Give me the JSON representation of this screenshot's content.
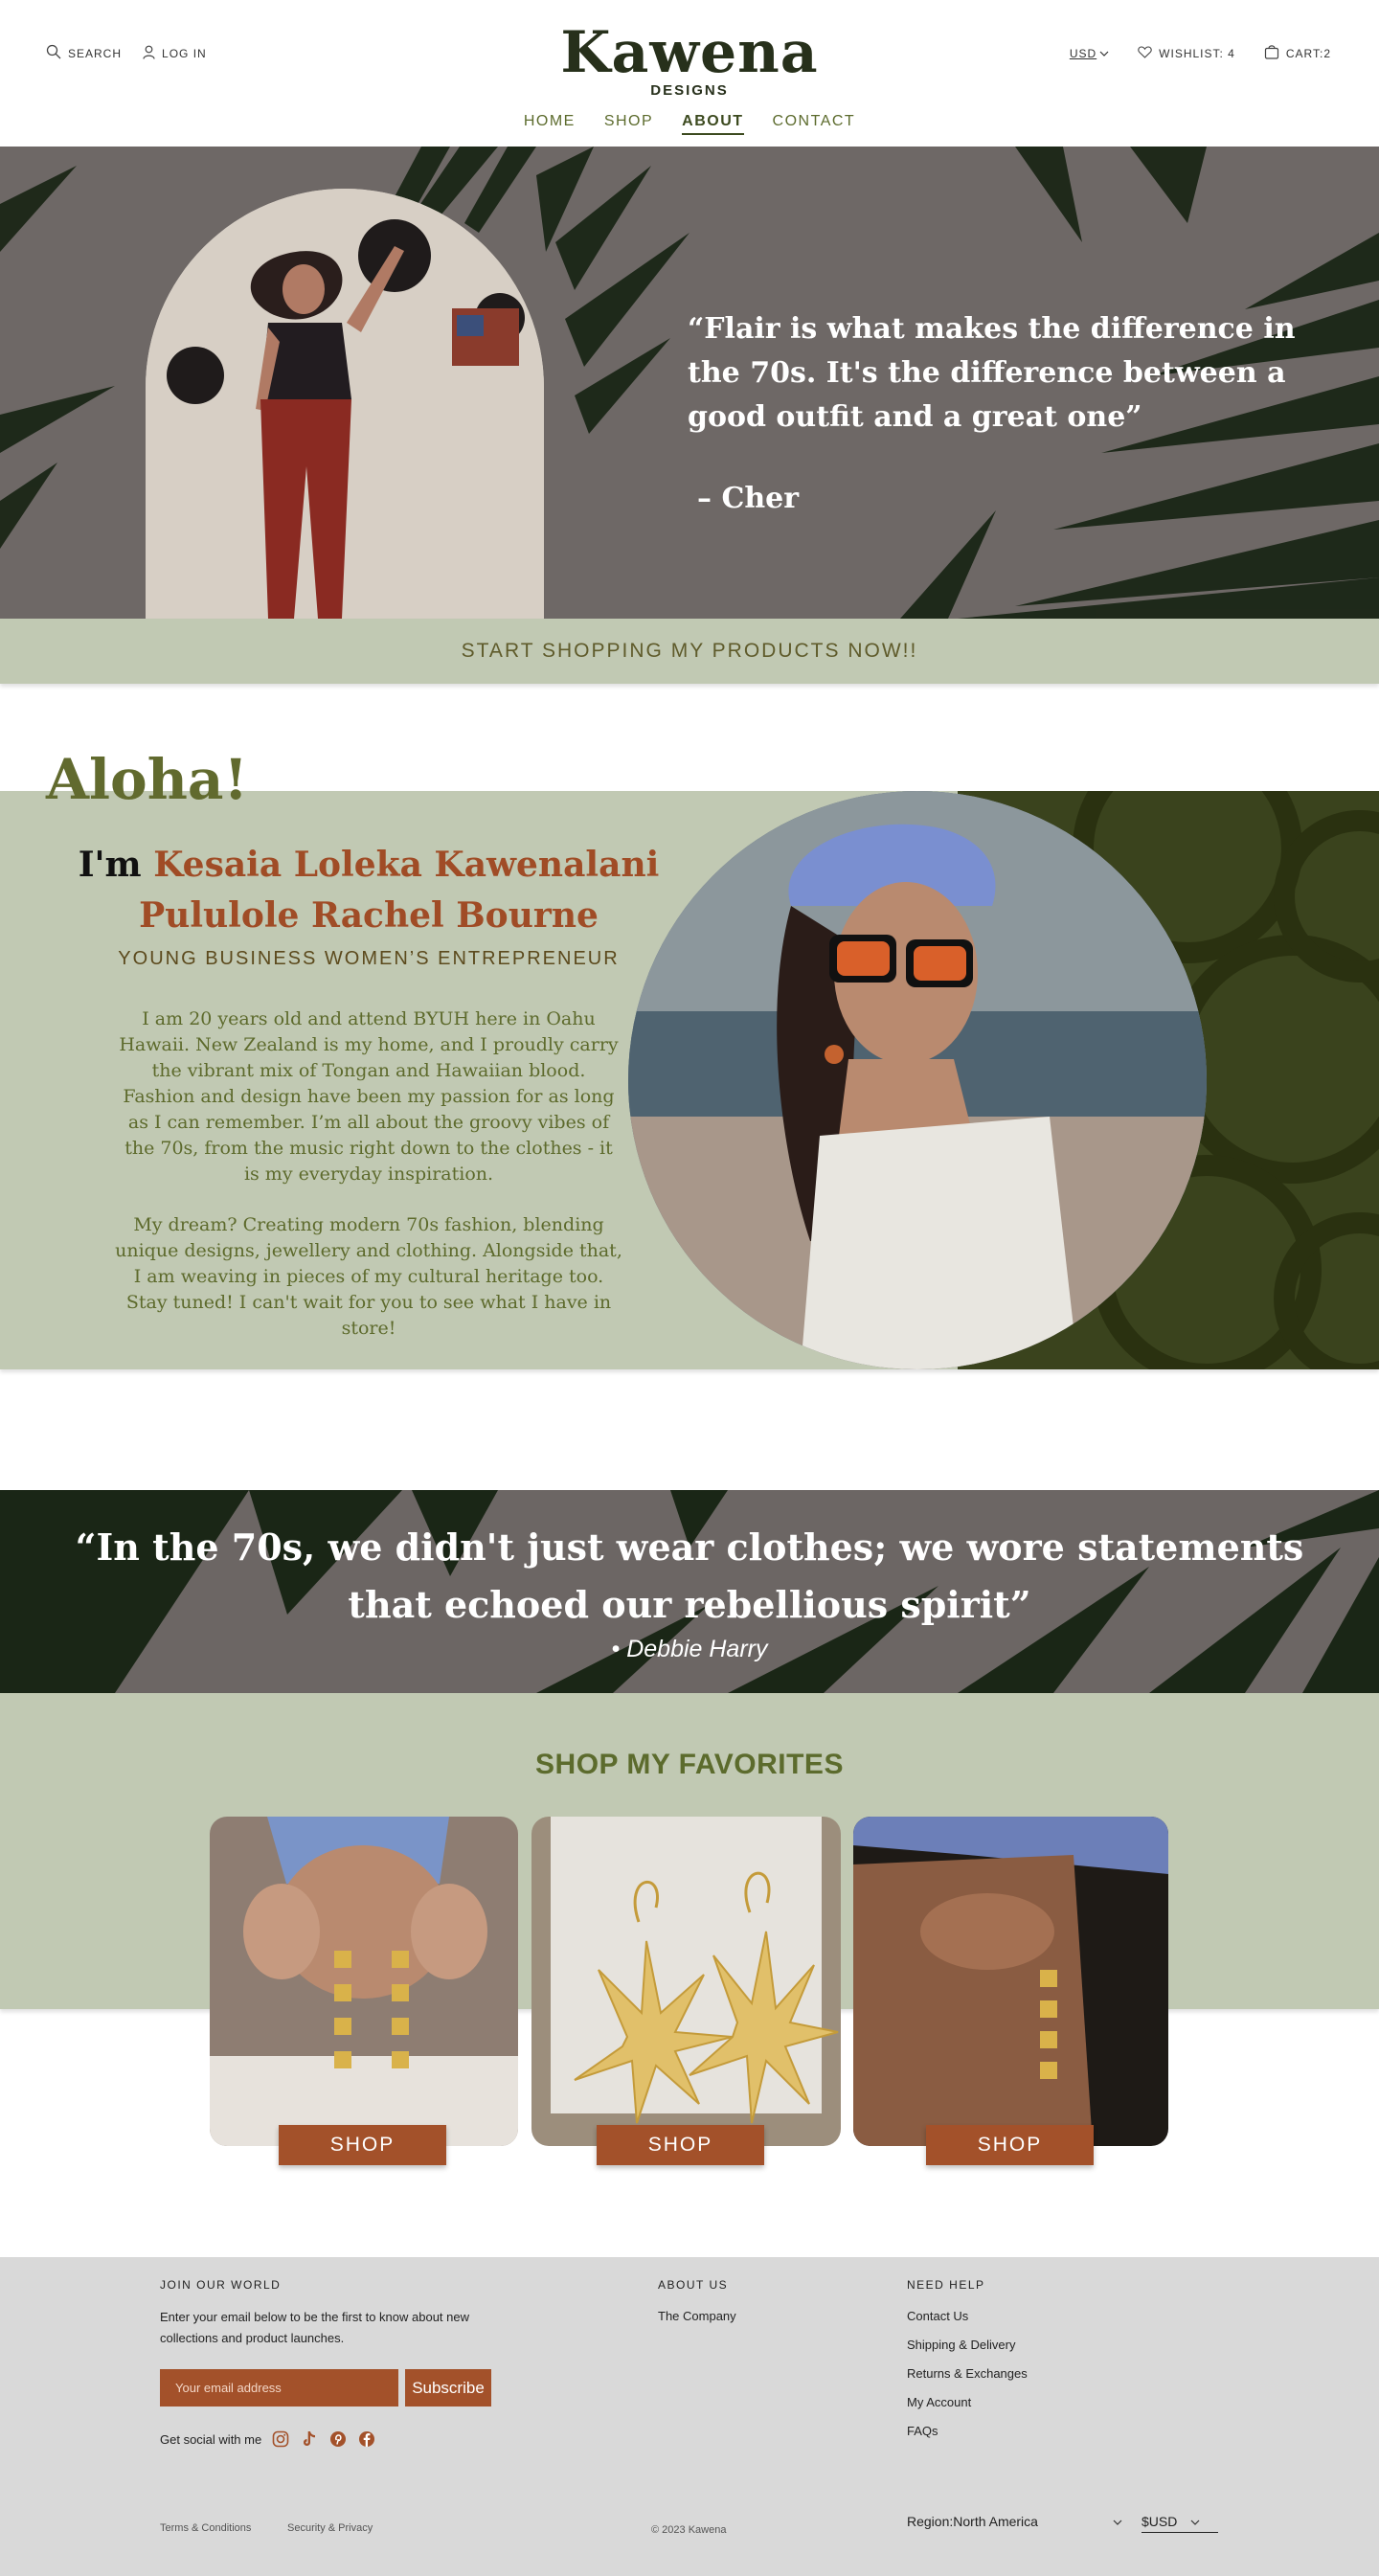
{
  "header": {
    "search_label": "SEARCH",
    "login_label": "LOG IN",
    "logo": "Kawena",
    "logo_sub": "DESIGNS",
    "currency": "USD",
    "wishlist_label": "WISHLIST: 4",
    "cart_label": "CART:2"
  },
  "nav": {
    "items": [
      "HOME",
      "SHOP",
      "ABOUT",
      "CONTACT"
    ],
    "active": "ABOUT"
  },
  "hero": {
    "quote": "“Flair is what makes the difference in the 70s.  It's the difference between a good outfit and a great one”",
    "attribution": "– Cher"
  },
  "cta": {
    "label": "START SHOPPING MY PRODUCTS NOW!!"
  },
  "about": {
    "greeting": "Aloha!",
    "im": "I'm",
    "name_line1": "Kesaia Loleka Kawenalani",
    "name_line2": "Pululole Rachel Bourne",
    "tagline": "YOUNG BUSINESS WOMEN’S ENTREPRENEUR",
    "bio1": "I am 20 years old and attend BYUH here in Oahu Hawaii.  New Zealand is my home, and I proudly carry the vibrant mix of Tongan and Hawaiian blood. Fashion and design have been my passion for as long as I can remember.  I’m all about the groovy vibes of the 70s, from the music right down to the clothes - it is my everyday inspiration.",
    "bio2": "My dream? Creating modern 70s fashion, blending unique designs, jewellery and clothing.  Alongside that, I am weaving in pieces of my cultural heritage too. Stay tuned!  I can't wait for you to see what I have in store!"
  },
  "quote2": {
    "text": "“In the 70s, we didn't just wear clothes; we wore statements that echoed our rebellious spirit”",
    "attribution": "Debbie Harry"
  },
  "favorites": {
    "title": "SHOP MY FAVORITES",
    "products": [
      {
        "button": "SHOP"
      },
      {
        "button": "SHOP"
      },
      {
        "button": "SHOP"
      }
    ]
  },
  "footer": {
    "join_title": "JOIN OUR WORLD",
    "join_text": "Enter your email below to be the first to know about new collections and product launches.",
    "email_placeholder": "Your email address",
    "subscribe": "Subscribe",
    "social_label": "Get social with me",
    "about_title": "ABOUT US",
    "about_links": [
      "The Company"
    ],
    "help_title": "NEED HELP",
    "help_links": [
      "Contact Us",
      "Shipping & Delivery",
      "Returns & Exchanges",
      "My Account",
      "FAQs"
    ],
    "terms": "Terms & Conditions",
    "security": "Security & Privacy",
    "copyright": "© 2023 Kawena",
    "region": "Region:North America",
    "currency": "$USD"
  },
  "colors": {
    "olive_dark": "#27301b",
    "olive": "#5c6b2d",
    "sage": "#c1c9b3",
    "rust": "#a3512a",
    "footer_bg": "#d9d9d9"
  }
}
